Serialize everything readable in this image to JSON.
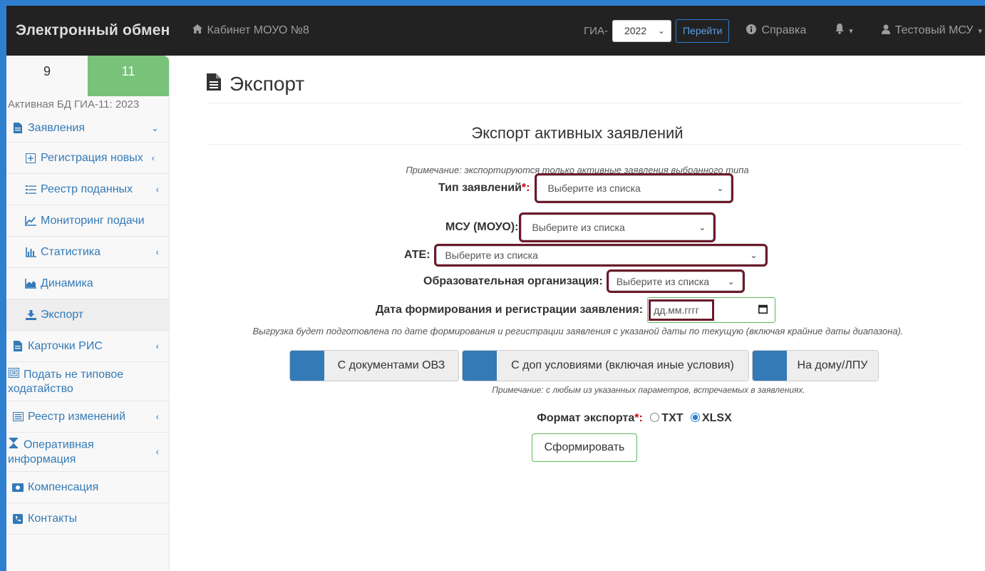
{
  "navbar": {
    "brand": "Электронный обмен",
    "cabinet": "Кабинет МОУО №8",
    "gia_label": "ГИА-",
    "year_value": "2022",
    "go_button": "Перейти",
    "help": "Справка",
    "user": "Тестовый МСУ"
  },
  "sidebar": {
    "class_tabs": [
      "9",
      "11"
    ],
    "active_db": "Активная БД ГИА-11: 2023",
    "items": {
      "applications": "Заявления",
      "register_new": "Регистрация новых",
      "registry": "Реестр поданных",
      "monitoring": "Мониторинг подачи",
      "statistics": "Статистика",
      "dynamics": "Динамика",
      "export": "Экспорт",
      "ris_cards": "Карточки РИС",
      "nonstandard_1": "Подать не типовое",
      "nonstandard_2": "ходатайство",
      "changes_registry": "Реестр изменений",
      "operative_1": "Оперативная",
      "operative_2": "информация",
      "compensation": "Компенсация",
      "contacts": "Контакты"
    }
  },
  "main": {
    "page_title": "Экспорт",
    "section_title": "Экспорт активных заявлений",
    "note_active": "Примечание: экспортируются только активные заявления выбранного типа",
    "type_label": "Тип заявлений",
    "req_mark": "*:",
    "msu_label": "МСУ (МОУО):",
    "ate_label": "АТЕ:",
    "org_label": "Образовательная организация:",
    "date_label": "Дата формирования и регистрации заявления:",
    "select_placeholder": "Выберите из списка",
    "date_placeholder": "дд.мм.гггг",
    "note_date": "Выгрузка будет подготовлена по дате формирования и регистрации заявления с указаной даты по текущую (включая крайние даты диапазона).",
    "toggle_ovz": "С документами ОВЗ",
    "toggle_extra": "С доп условиями (включая иные условия)",
    "toggle_home": "На дому/ЛПУ",
    "note_params": "Примечание: с любым из указанных параметров, встречаемых в заявлениях.",
    "format_label": "Формат экспорта",
    "format_req": "*:",
    "format_txt": "TXT",
    "format_xlsx": "XLSX",
    "format_selected": "XLSX",
    "submit": "Сформировать"
  }
}
